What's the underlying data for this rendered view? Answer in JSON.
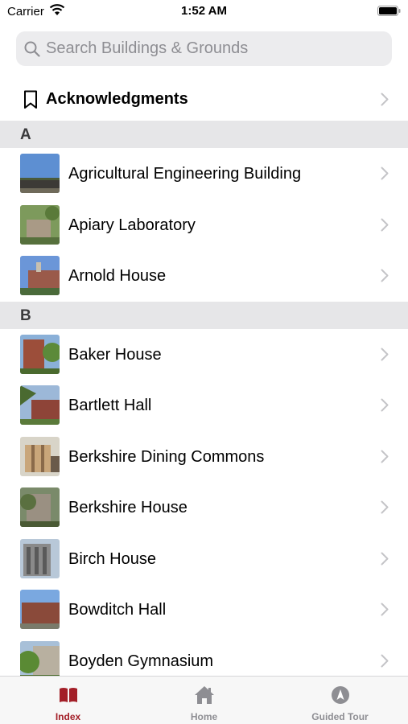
{
  "status_bar": {
    "carrier": "Carrier",
    "time": "1:52 AM"
  },
  "search": {
    "placeholder": "Search Buildings & Grounds"
  },
  "acknowledgments": {
    "label": "Acknowledgments"
  },
  "sections": [
    {
      "letter": "A",
      "items": [
        {
          "label": "Agricultural Engineering Building"
        },
        {
          "label": "Apiary Laboratory"
        },
        {
          "label": "Arnold House"
        }
      ]
    },
    {
      "letter": "B",
      "items": [
        {
          "label": "Baker House"
        },
        {
          "label": "Bartlett Hall"
        },
        {
          "label": "Berkshire Dining Commons"
        },
        {
          "label": "Berkshire House"
        },
        {
          "label": "Birch House"
        },
        {
          "label": "Bowditch Hall"
        },
        {
          "label": "Boyden Gymnasium"
        }
      ]
    }
  ],
  "tab_bar": {
    "tabs": [
      {
        "label": "Index",
        "icon": "book-icon",
        "active": true
      },
      {
        "label": "Home",
        "icon": "house-icon",
        "active": false
      },
      {
        "label": "Guided Tour",
        "icon": "compass-icon",
        "active": false
      }
    ]
  },
  "colors": {
    "accent": "#a31f28",
    "inactive": "#8e8e93",
    "section_bg": "#e6e6e8",
    "search_bg": "#ececee"
  }
}
